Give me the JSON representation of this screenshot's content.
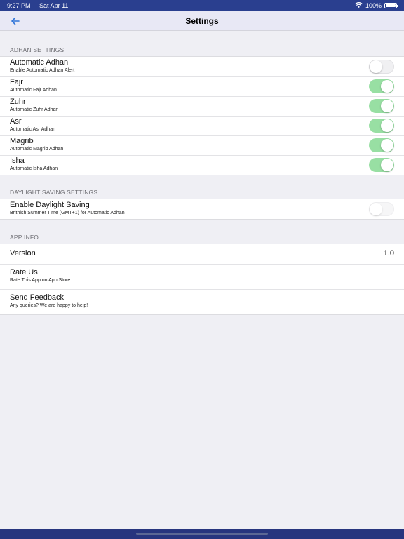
{
  "status_bar": {
    "time": "9:27 PM",
    "date": "Sat Apr 11",
    "battery": "100%",
    "icons": [
      "wifi-icon",
      "battery-icon"
    ]
  },
  "nav": {
    "title": "Settings",
    "back_icon": "back-arrow-icon",
    "accent_color": "#2f74d8"
  },
  "adhan_section": {
    "header": "ADHAN SETTINGS",
    "rows": [
      {
        "title": "Automatic Adhan",
        "subtitle": "Enable Automatic Adhan Alert",
        "toggle": false
      },
      {
        "title": "Fajr",
        "subtitle": "Automatic Fajr Adhan",
        "toggle": true
      },
      {
        "title": "Zuhr",
        "subtitle": "Automatic Zuhr Adhan",
        "toggle": true
      },
      {
        "title": "Asr",
        "subtitle": "Automatic Asr Adhan",
        "toggle": true
      },
      {
        "title": "Magrib",
        "subtitle": "Automatic Magrib Adhan",
        "toggle": true
      },
      {
        "title": "Isha",
        "subtitle": "Automatic Isha Adhan",
        "toggle": true
      }
    ]
  },
  "daylight_section": {
    "header": "DAYLIGHT SAVING SETTINGS",
    "rows": [
      {
        "title": "Enable Daylight Saving",
        "subtitle": "Brithish Summer Time (GMT+1) for Automatic Adhan",
        "toggle": false
      }
    ]
  },
  "app_info_section": {
    "header": "APP INFO",
    "version": {
      "title": "Version",
      "value": "1.0"
    },
    "rate": {
      "title": "Rate Us",
      "subtitle": "Rate This App on App Store"
    },
    "feedback": {
      "title": "Send Feedback",
      "subtitle": "Any queries? We are happy to help!"
    }
  },
  "colors": {
    "status_bar": "#2a3f8f",
    "toggle_on": "#98dfa3",
    "toggle_off": "#f0f0f2",
    "background": "#efeff4"
  }
}
